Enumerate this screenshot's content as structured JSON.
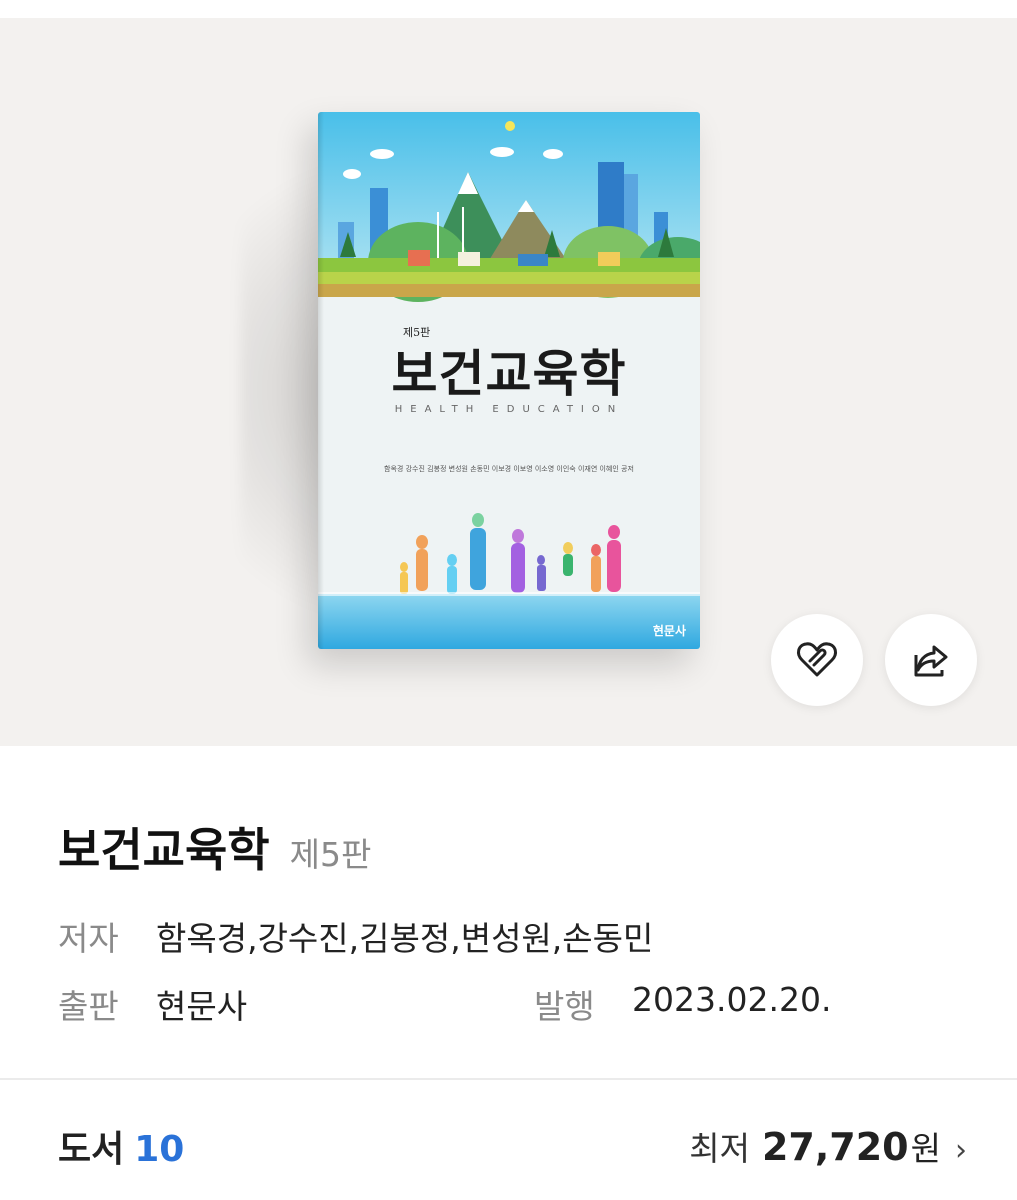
{
  "cover": {
    "edition": "제5판",
    "title": "보건교육학",
    "subtitle": "HEALTH EDUCATION",
    "authors": "함옥경 강수진 김봉정 변성원 손동민 이보경 이보영 이소영 이인숙 이재연 이혜인 공저",
    "publisher": "현문사"
  },
  "actions": {
    "wishlist_icon": "heart-icon",
    "share_icon": "share-icon"
  },
  "book": {
    "title": "보건교육학",
    "edition": "제5판",
    "author_label": "저자",
    "authors": "함옥경,강수진,김봉정,변성원,손동민",
    "publisher_label": "출판",
    "publisher": "현문사",
    "date_label": "발행",
    "date": "2023.02.20."
  },
  "listing": {
    "books_label": "도서",
    "books_count": "10",
    "min_label": "최저",
    "min_price": "27,720",
    "currency": "원",
    "chevron_icon": "chevron-right-icon"
  },
  "colors": {
    "hero_bg": "#f3f1ef",
    "accent": "#2a72d8",
    "muted": "#8a8a8a"
  }
}
